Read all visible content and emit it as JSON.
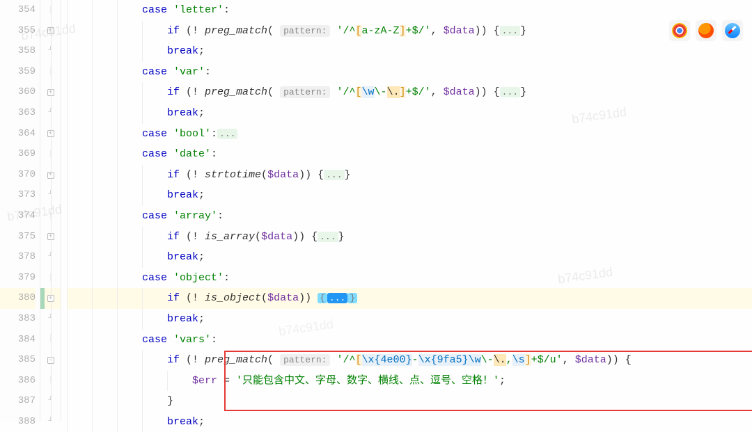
{
  "watermark": "b74c91dd",
  "browser_icons": [
    "chrome-icon",
    "firefox-icon",
    "safari-icon"
  ],
  "highlighted_line_number": 380,
  "red_box_lines": [
    385,
    386,
    387
  ],
  "lines": [
    {
      "n": 354,
      "indent": 3,
      "tokens": [
        {
          "t": "case ",
          "c": "kw"
        },
        {
          "t": "'letter'",
          "c": "str"
        },
        {
          "t": ":",
          "c": ""
        }
      ],
      "fold": "mid"
    },
    {
      "n": 355,
      "indent": 4,
      "tokens": [
        {
          "t": "if ",
          "c": "kw"
        },
        {
          "t": "(! ",
          "c": ""
        },
        {
          "t": "preg_match",
          "c": "fn"
        },
        {
          "t": "( ",
          "c": ""
        },
        {
          "t": "pattern:",
          "c": "hint"
        },
        {
          "t": " ",
          "c": ""
        },
        {
          "t": "'/^",
          "c": "str"
        },
        {
          "t": "[",
          "c": "regex-brace"
        },
        {
          "t": "a-zA-Z",
          "c": "str"
        },
        {
          "t": "]",
          "c": "regex-brace"
        },
        {
          "t": "+$/'",
          "c": "str"
        },
        {
          "t": ", ",
          "c": ""
        },
        {
          "t": "$data",
          "c": "var"
        },
        {
          "t": ")) {",
          "c": ""
        },
        {
          "t": "...",
          "c": "fold-dots"
        },
        {
          "t": "}",
          "c": ""
        }
      ],
      "fold": "plus"
    },
    {
      "n": 358,
      "indent": 4,
      "tokens": [
        {
          "t": "break",
          "c": "kw"
        },
        {
          "t": ";",
          "c": ""
        }
      ],
      "fold": "end"
    },
    {
      "n": 359,
      "indent": 3,
      "tokens": [
        {
          "t": "case ",
          "c": "kw"
        },
        {
          "t": "'var'",
          "c": "str"
        },
        {
          "t": ":",
          "c": ""
        }
      ],
      "fold": "mid"
    },
    {
      "n": 360,
      "indent": 4,
      "tokens": [
        {
          "t": "if ",
          "c": "kw"
        },
        {
          "t": "(! ",
          "c": ""
        },
        {
          "t": "preg_match",
          "c": "fn"
        },
        {
          "t": "( ",
          "c": ""
        },
        {
          "t": "pattern:",
          "c": "hint"
        },
        {
          "t": " ",
          "c": ""
        },
        {
          "t": "'/^",
          "c": "str"
        },
        {
          "t": "[",
          "c": "regex-brace"
        },
        {
          "t": "\\w",
          "c": "regex-esc"
        },
        {
          "t": "\\-",
          "c": "str"
        },
        {
          "t": "\\.",
          "c": "regex-hl"
        },
        {
          "t": "]",
          "c": "regex-brace"
        },
        {
          "t": "+$/'",
          "c": "str"
        },
        {
          "t": ", ",
          "c": ""
        },
        {
          "t": "$data",
          "c": "var"
        },
        {
          "t": ")) {",
          "c": ""
        },
        {
          "t": "...",
          "c": "fold-dots"
        },
        {
          "t": "}",
          "c": ""
        }
      ],
      "fold": "plus"
    },
    {
      "n": 363,
      "indent": 4,
      "tokens": [
        {
          "t": "break",
          "c": "kw"
        },
        {
          "t": ";",
          "c": ""
        }
      ],
      "fold": "end"
    },
    {
      "n": 364,
      "indent": 3,
      "tokens": [
        {
          "t": "case ",
          "c": "kw"
        },
        {
          "t": "'bool'",
          "c": "str"
        },
        {
          "t": ":",
          "c": ""
        },
        {
          "t": "...",
          "c": "fold-dots"
        }
      ],
      "fold": "plus"
    },
    {
      "n": 369,
      "indent": 3,
      "tokens": [
        {
          "t": "case ",
          "c": "kw"
        },
        {
          "t": "'date'",
          "c": "str"
        },
        {
          "t": ":",
          "c": ""
        }
      ],
      "fold": "mid"
    },
    {
      "n": 370,
      "indent": 4,
      "tokens": [
        {
          "t": "if ",
          "c": "kw"
        },
        {
          "t": "(! ",
          "c": ""
        },
        {
          "t": "strtotime",
          "c": "fn"
        },
        {
          "t": "(",
          "c": ""
        },
        {
          "t": "$data",
          "c": "var"
        },
        {
          "t": ")) {",
          "c": ""
        },
        {
          "t": "...",
          "c": "fold-dots"
        },
        {
          "t": "}",
          "c": ""
        }
      ],
      "fold": "plus"
    },
    {
      "n": 373,
      "indent": 4,
      "tokens": [
        {
          "t": "break",
          "c": "kw"
        },
        {
          "t": ";",
          "c": ""
        }
      ],
      "fold": "end"
    },
    {
      "n": 374,
      "indent": 3,
      "tokens": [
        {
          "t": "case ",
          "c": "kw"
        },
        {
          "t": "'array'",
          "c": "str"
        },
        {
          "t": ":",
          "c": ""
        }
      ],
      "fold": "mid"
    },
    {
      "n": 375,
      "indent": 4,
      "tokens": [
        {
          "t": "if ",
          "c": "kw"
        },
        {
          "t": "(! ",
          "c": ""
        },
        {
          "t": "is_array",
          "c": "fn"
        },
        {
          "t": "(",
          "c": ""
        },
        {
          "t": "$data",
          "c": "var"
        },
        {
          "t": ")) {",
          "c": ""
        },
        {
          "t": "...",
          "c": "fold-dots"
        },
        {
          "t": "}",
          "c": ""
        }
      ],
      "fold": "plus"
    },
    {
      "n": 378,
      "indent": 4,
      "tokens": [
        {
          "t": "break",
          "c": "kw"
        },
        {
          "t": ";",
          "c": ""
        }
      ],
      "fold": "end"
    },
    {
      "n": 379,
      "indent": 3,
      "tokens": [
        {
          "t": "case ",
          "c": "kw"
        },
        {
          "t": "'object'",
          "c": "str"
        },
        {
          "t": ":",
          "c": ""
        }
      ],
      "fold": "mid"
    },
    {
      "n": 380,
      "indent": 4,
      "tokens": [
        {
          "t": "if ",
          "c": "kw"
        },
        {
          "t": "(! ",
          "c": ""
        },
        {
          "t": "is_object",
          "c": "fn"
        },
        {
          "t": "(",
          "c": ""
        },
        {
          "t": "$data",
          "c": "var"
        },
        {
          "t": ")) ",
          "c": ""
        },
        {
          "t": "{",
          "c": "fold-dots hl-brace"
        },
        {
          "t": "...",
          "c": "fold-dots selected"
        },
        {
          "t": "}",
          "c": "fold-dots hl-brace"
        }
      ],
      "fold": "plus",
      "caret": true
    },
    {
      "n": 383,
      "indent": 4,
      "tokens": [
        {
          "t": "break",
          "c": "kw"
        },
        {
          "t": ";",
          "c": ""
        }
      ],
      "fold": "end"
    },
    {
      "n": 384,
      "indent": 3,
      "tokens": [
        {
          "t": "case ",
          "c": "kw"
        },
        {
          "t": "'vars'",
          "c": "str"
        },
        {
          "t": ":",
          "c": ""
        }
      ],
      "fold": "mid"
    },
    {
      "n": 385,
      "indent": 4,
      "tokens": [
        {
          "t": "if ",
          "c": "kw"
        },
        {
          "t": "(! ",
          "c": ""
        },
        {
          "t": "preg_match",
          "c": "fn"
        },
        {
          "t": "( ",
          "c": ""
        },
        {
          "t": "pattern:",
          "c": "hint"
        },
        {
          "t": " ",
          "c": ""
        },
        {
          "t": "'/^",
          "c": "str"
        },
        {
          "t": "[",
          "c": "regex-brace"
        },
        {
          "t": "\\x{4e00}",
          "c": "regex-esc"
        },
        {
          "t": "-",
          "c": "str"
        },
        {
          "t": "\\x{9fa5}",
          "c": "regex-esc"
        },
        {
          "t": "\\w",
          "c": "regex-esc"
        },
        {
          "t": "\\-",
          "c": "str"
        },
        {
          "t": "\\.",
          "c": "regex-hl"
        },
        {
          "t": ",",
          "c": "str"
        },
        {
          "t": "\\s",
          "c": "regex-esc"
        },
        {
          "t": "]",
          "c": "regex-brace"
        },
        {
          "t": "+$/u'",
          "c": "str"
        },
        {
          "t": ", ",
          "c": ""
        },
        {
          "t": "$data",
          "c": "var"
        },
        {
          "t": ")) {",
          "c": ""
        }
      ],
      "fold": "minus"
    },
    {
      "n": 386,
      "indent": 5,
      "tokens": [
        {
          "t": "$err",
          "c": "var"
        },
        {
          "t": " = ",
          "c": ""
        },
        {
          "t": "'只能包含中文、字母、数字、横线、点、逗号、空格！'",
          "c": "str"
        },
        {
          "t": ";",
          "c": ""
        }
      ],
      "fold": "mid"
    },
    {
      "n": 387,
      "indent": 4,
      "tokens": [
        {
          "t": "}",
          "c": ""
        }
      ],
      "fold": "end"
    },
    {
      "n": 388,
      "indent": 4,
      "tokens": [
        {
          "t": "break",
          "c": "kw"
        },
        {
          "t": ";",
          "c": ""
        }
      ],
      "fold": "end"
    }
  ]
}
